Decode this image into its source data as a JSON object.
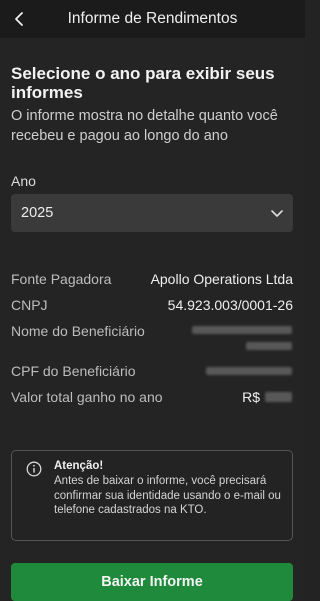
{
  "header": {
    "title": "Informe de Rendimentos",
    "back_icon": "chevron-left-icon"
  },
  "section": {
    "title": "Selecione o ano para exibir seus informes",
    "description": "O informe mostra no detalhe quanto você recebeu e pagou ao longo do ano"
  },
  "year": {
    "label": "Ano",
    "selected": "2025",
    "icon": "chevron-down-icon"
  },
  "details": {
    "payer_label": "Fonte Pagadora",
    "payer_value": "Apollo Operations Ltda",
    "cnpj_label": "CNPJ",
    "cnpj_value": "54.923.003/0001-26",
    "beneficiary_label": "Nome do Beneficiário",
    "cpf_label": "CPF do Beneficiário",
    "total_label": "Valor total ganho no ano",
    "total_currency": "R$"
  },
  "warning": {
    "title": "Atenção!",
    "text": "Antes de baixar o informe, você precisará confirmar sua identidade usando o e-mail ou telefone cadastrados na KTO.",
    "icon": "info-icon"
  },
  "button": {
    "label": "Baixar Informe",
    "color": "#1f8a3b"
  }
}
